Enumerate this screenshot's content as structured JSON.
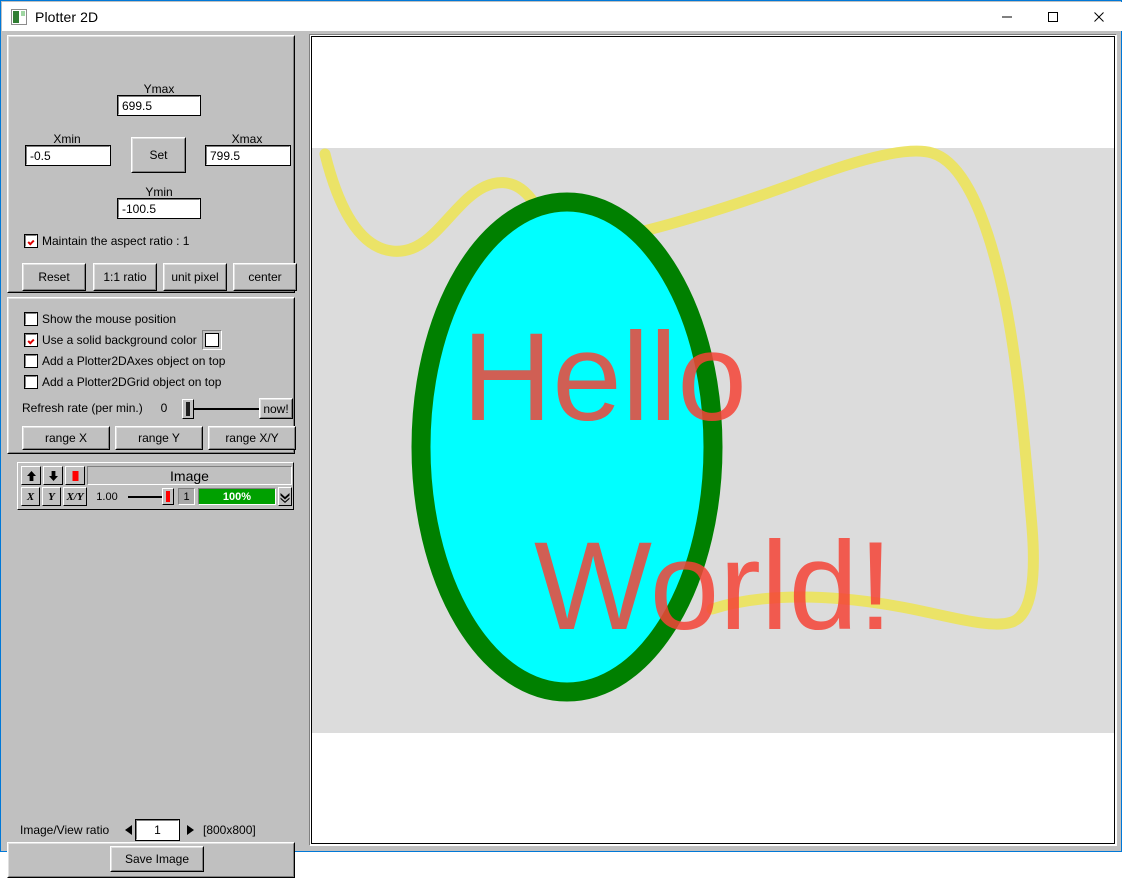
{
  "window": {
    "title": "Plotter 2D",
    "icon": "plotter-icon",
    "controls": [
      {
        "name": "minimize",
        "glyph": "—"
      },
      {
        "name": "maximize",
        "glyph": "□"
      },
      {
        "name": "close",
        "glyph": "✕"
      }
    ]
  },
  "range_panel": {
    "ymax_label": "Ymax",
    "ymax_value": "699.5",
    "xmin_label": "Xmin",
    "xmin_value": "-0.5",
    "xmax_label": "Xmax",
    "xmax_value": "799.5",
    "ymin_label": "Ymin",
    "ymin_value": "-100.5",
    "set_label": "Set",
    "aspect_checkbox": {
      "label": "Maintain the aspect ratio : 1",
      "checked": true
    },
    "buttons": [
      "Reset",
      "1:1 ratio",
      "unit pixel",
      "center"
    ]
  },
  "options_panel": {
    "checkboxes": [
      {
        "label": "Show the mouse position",
        "checked": false
      },
      {
        "label": "Use a solid background color",
        "checked": true
      },
      {
        "label": "Add a Plotter2DAxes object on top",
        "checked": false
      },
      {
        "label": "Add a Plotter2DGrid object on top",
        "checked": false
      }
    ],
    "bg_color_swatch": "#ffffff",
    "refresh_label": "Refresh rate (per min.)",
    "refresh_value": "0",
    "now_label": "now!",
    "range_buttons": [
      "range X",
      "range Y",
      "range X/Y"
    ]
  },
  "layer_panel": {
    "up_icon": "arrow-up-icon",
    "down_icon": "arrow-down-icon",
    "stop_icon": "stop-square-icon",
    "title": "Image",
    "axis_buttons": [
      "X",
      "Y",
      "X/Y"
    ],
    "opacity_value": "1.00",
    "layer_index": "1",
    "progress_label": "100%",
    "progress_color": "#00a000",
    "expand_icon": "double-chevron-down-icon"
  },
  "footer": {
    "ratio_label": "Image/View ratio",
    "prev_icon": "triangle-left-icon",
    "ratio_value": "1",
    "next_icon": "triangle-right-icon",
    "dimensions": "[800x800]",
    "save_label": "Save Image"
  },
  "plot": {
    "background": "#ffffff",
    "plot_area_color": "#dcdcdc",
    "ellipse": {
      "fill": "#00ffff",
      "stroke": "#008000",
      "stroke_width": 20
    },
    "curve_color": "#eee45a",
    "text_color": "#f44336",
    "lines": [
      "Hello",
      "World!"
    ]
  }
}
